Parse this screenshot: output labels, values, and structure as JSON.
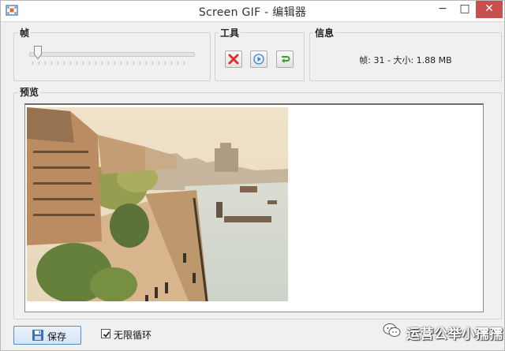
{
  "window": {
    "title": "Screen GIF - 编辑器",
    "min_glyph": "−",
    "max_glyph": "□",
    "close_glyph": "✕"
  },
  "frames": {
    "label": "帧",
    "position_fraction": 0.03
  },
  "tools": {
    "label": "工具",
    "buttons": [
      {
        "icon": "delete-x-icon",
        "color": "#d9322b"
      },
      {
        "icon": "play-icon",
        "color": "#3b82c7"
      },
      {
        "icon": "loop-arrow-icon",
        "color": "#3d9b2f"
      }
    ]
  },
  "info": {
    "label": "信息",
    "text": "帧: 31 - 大小: 1.88 MB"
  },
  "preview": {
    "label": "预览"
  },
  "footer": {
    "save_label": "保存",
    "loop_label": "无限循环",
    "loop_checked": true
  },
  "watermark": {
    "text": "运营公举小孺孺",
    "icon": "wechat-icon"
  },
  "colors": {
    "close_button": "#c7504e",
    "window_bg": "#f0f0f0",
    "accent_border": "#5c88c4"
  }
}
